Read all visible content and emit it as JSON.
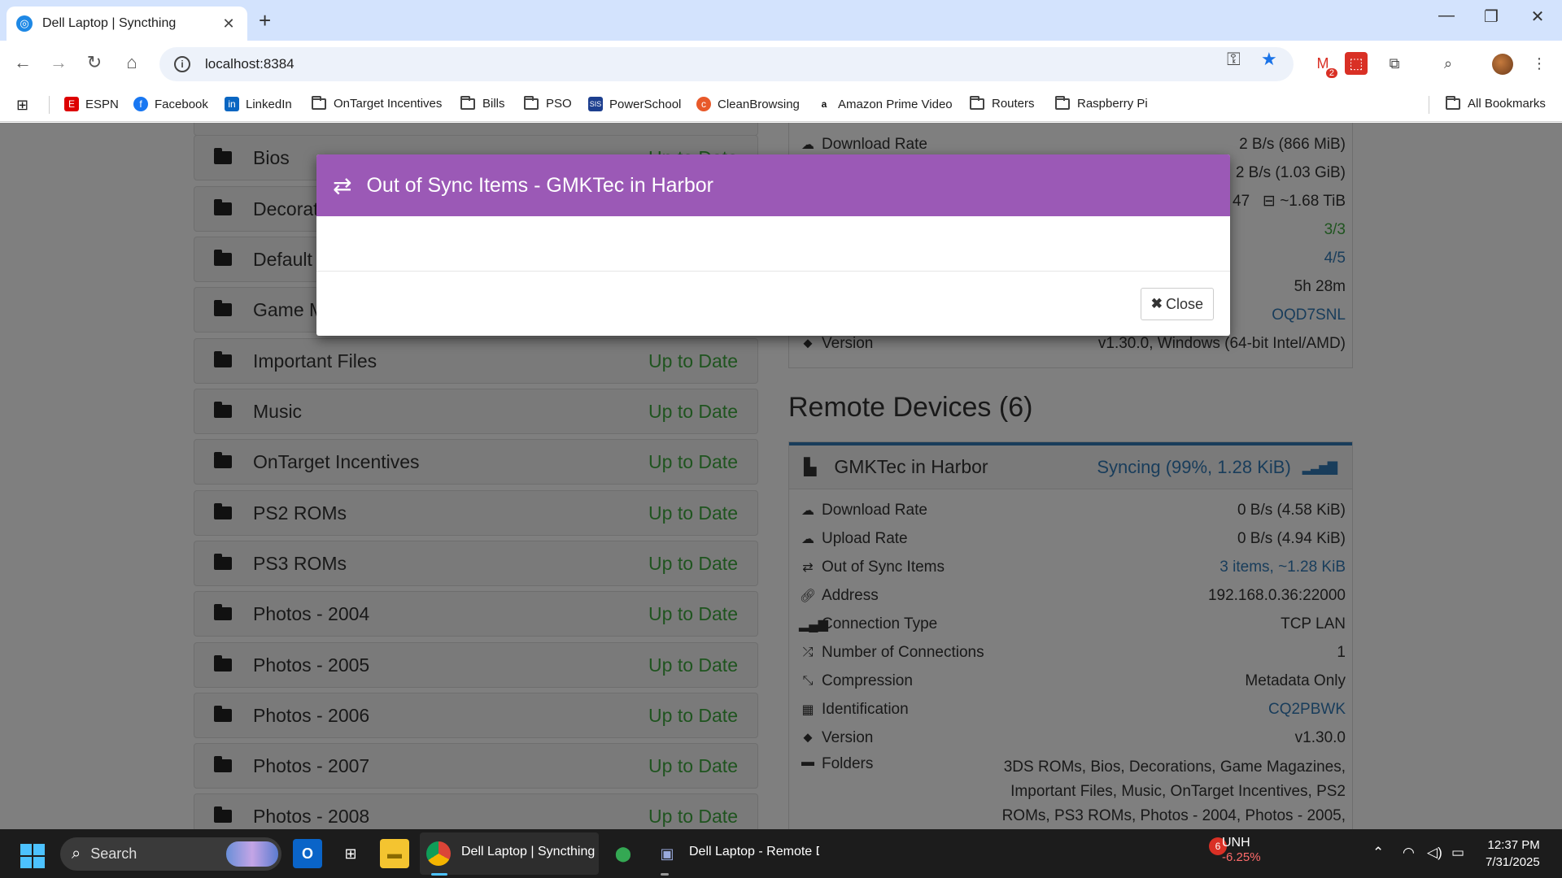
{
  "browser": {
    "tab_title": "Dell Laptop | Syncthing",
    "url": "localhost:8384",
    "bookmarks": [
      {
        "label": "ESPN",
        "icon": "espn-icon"
      },
      {
        "label": "Facebook",
        "icon": "facebook-icon"
      },
      {
        "label": "LinkedIn",
        "icon": "linkedin-icon"
      },
      {
        "label": "OnTarget Incentives",
        "icon": "folder-icon"
      },
      {
        "label": "Bills",
        "icon": "folder-icon"
      },
      {
        "label": "PSO",
        "icon": "folder-icon"
      },
      {
        "label": "PowerSchool",
        "icon": "powerschool-icon"
      },
      {
        "label": "CleanBrowsing",
        "icon": "cleanbrowsing-icon"
      },
      {
        "label": "Amazon Prime Video",
        "icon": "amazon-icon"
      },
      {
        "label": "Routers",
        "icon": "folder-icon"
      },
      {
        "label": "Raspberry Pi",
        "icon": "folder-icon"
      }
    ],
    "all_bookmarks": "All Bookmarks",
    "gmail_badge": "2"
  },
  "folders": [
    {
      "name": "Bios",
      "status": "Up to Date"
    },
    {
      "name": "Decorat",
      "status": ""
    },
    {
      "name": "Default",
      "status": ""
    },
    {
      "name": "Game M",
      "status": ""
    },
    {
      "name": "Important Files",
      "status": "Up to Date"
    },
    {
      "name": "Music",
      "status": "Up to Date"
    },
    {
      "name": "OnTarget Incentives",
      "status": "Up to Date"
    },
    {
      "name": "PS2 ROMs",
      "status": "Up to Date"
    },
    {
      "name": "PS3 ROMs",
      "status": "Up to Date"
    },
    {
      "name": "Photos - 2004",
      "status": "Up to Date"
    },
    {
      "name": "Photos - 2005",
      "status": "Up to Date"
    },
    {
      "name": "Photos - 2006",
      "status": "Up to Date"
    },
    {
      "name": "Photos - 2007",
      "status": "Up to Date"
    },
    {
      "name": "Photos - 2008",
      "status": "Up to Date"
    }
  ],
  "this_device": {
    "download_label": "Download Rate",
    "download_value": "2 B/s (866 MiB)",
    "upload_value": "2 B/s (1.03 GiB)",
    "local_state_value": "47",
    "local_size_value": "~1.68 TiB",
    "listeners_value": "3/3",
    "discovery_value": "4/5",
    "uptime_value": "5h 28m",
    "id_value": "OQD7SNL",
    "version_label": "Version",
    "version_value": "v1.30.0, Windows (64-bit Intel/AMD)"
  },
  "remote": {
    "title": "Remote Devices (6)",
    "device_name": "GMKTec in Harbor",
    "device_status": "Syncing (99%, 1.28 KiB)",
    "rows": [
      {
        "icon": "cloud-download-icon",
        "label": "Download Rate",
        "value": "0 B/s (4.58 KiB)",
        "style": ""
      },
      {
        "icon": "cloud-upload-icon",
        "label": "Upload Rate",
        "value": "0 B/s (4.94 KiB)",
        "style": ""
      },
      {
        "icon": "exchange-icon",
        "label": "Out of Sync Items",
        "value": "3 items, ~1.28 KiB",
        "style": "link"
      },
      {
        "icon": "link-icon",
        "label": "Address",
        "value": "192.168.0.36:22000",
        "style": ""
      },
      {
        "icon": "signal-icon",
        "label": "Connection Type",
        "value": "TCP LAN",
        "style": ""
      },
      {
        "icon": "random-icon",
        "label": "Number of Connections",
        "value": "1",
        "style": ""
      },
      {
        "icon": "compress-icon",
        "label": "Compression",
        "value": "Metadata Only",
        "style": ""
      },
      {
        "icon": "qrcode-icon",
        "label": "Identification",
        "value": "CQ2PBWK",
        "style": "link"
      },
      {
        "icon": "tag-icon",
        "label": "Version",
        "value": "v1.30.0",
        "style": ""
      }
    ],
    "folders_label": "Folders",
    "folders_lines": [
      "3DS ROMs, Bios, Decorations, Game Magazines,",
      "Important Files, Music, OnTarget Incentives, PS2",
      "ROMs, PS3 ROMs, Photos - 2004, Photos - 2005,"
    ]
  },
  "modal": {
    "title": "Out of Sync Items - GMKTec in Harbor",
    "close_label": "Close"
  },
  "taskbar": {
    "search_placeholder": "Search",
    "chrome_label": "Dell Laptop | Syncthing",
    "remote_label": "Dell Laptop - Remote D",
    "stock_symbol": "UNH",
    "stock_change": "-6.25%",
    "notification_count": "6",
    "time": "12:37 PM",
    "date": "7/31/2025"
  },
  "colors": {
    "modal_header": "#9b59b6",
    "status_green": "#3fa93f",
    "link_blue": "#337ab7"
  }
}
